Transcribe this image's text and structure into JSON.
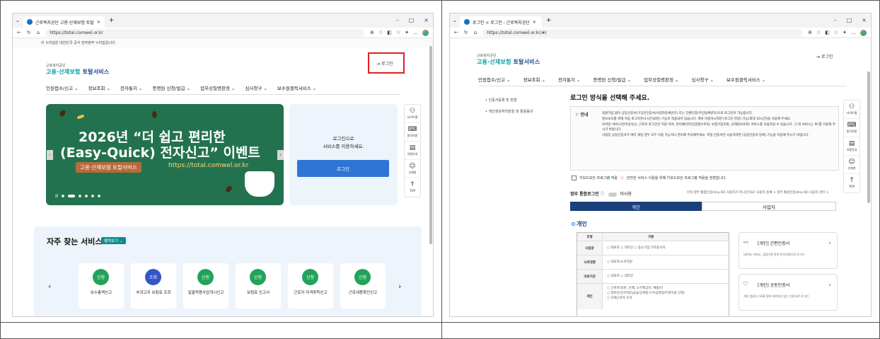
{
  "left": {
    "tab_title": "근로복지공단 고용·산재보험 토탈",
    "url": "https://total.comwel.or.kr",
    "gov_banner": "이 누리집은 대한민국 공식 전자정부 누리집입니다.",
    "brand_small": "근로복지공단",
    "brand_main_a": "고용·산재보험",
    "brand_main_b": " 토탈서비스",
    "login_link": "로그인",
    "nav": [
      "인원접수/신고 ⌄",
      "정보조회 ⌄",
      "전자통지 ⌄",
      "증명원 신청/발급 ⌄",
      "업무상질병판정 ⌄",
      "심사청구 ⌄",
      "보수원클릭서비스 ⌄"
    ],
    "hero": {
      "line1": "2026년 “더 쉽고 편리한",
      "line2": "(Easy-Quick) 전자신고” 이벤트",
      "pill": "고용·산재보험 토탈서비스",
      "url": "https://total.comwel.or.kr"
    },
    "login_box": {
      "line1": "로그인으로",
      "line2": "서비스를 이용하세요.",
      "button": "로그인"
    },
    "quick_nav": [
      "사이트맵",
      "원격지원",
      "이용안내",
      "산재봇",
      "TOP"
    ],
    "freq_title": "자주 찾는 서비스",
    "freq_more": "펼쳐보기 ⌄",
    "freq_cards": [
      {
        "badge": "신청",
        "label": "보수총액신고"
      },
      {
        "badge": "조회",
        "label": "부과고지 보험료 조회"
      },
      {
        "badge": "신청",
        "label": "일괄적용사업개시신고"
      },
      {
        "badge": "신청",
        "label": "보험료 신고서"
      },
      {
        "badge": "신청",
        "label": "근로자 자격취득신고"
      },
      {
        "badge": "신청",
        "label": "근로내용확인신고"
      }
    ]
  },
  "right": {
    "tab_title": "로그인 > 로그인 : 근로복지공단",
    "url": "https://total.comwel.or.kr/#/",
    "brand_small": "근로복지공단",
    "brand_main_a": "고용·산재보험",
    "brand_main_b": " 토탈서비스",
    "login_link": "로그인",
    "nav": [
      "민원접수/신고 ⌄",
      "정보조회 ⌄",
      "전자통지 ⌄",
      "증명원 신청/발급 ⌄",
      "업무상질병판정 ⌄",
      "심사청구 ⌄",
      "보수원클릭서비스 ⌄"
    ],
    "side": [
      "• 인증서등록 및 변경",
      "• 개인정보처리방침 및 활용동의"
    ],
    "heading": "로그인 방식을 선택해 주세요.",
    "notice_title": "안내",
    "notice": [
      "회원가입 없이 공동인증서(구공인인증서/사업자등록번호) 또는 간편인증(주민등록번호)으로 로그인이 가능합니다.",
      "정보보호를 위해 자동 로그아웃(1시간30분) 기능이 적용되어 있습니다. 계속 이용하시려면 [로그인 연장] 기능(최대 10시간)을 사용해 주세요.",
      "모바일 서비스(번호방식)는 근로자 로그인만 지원 하며, 마이페이지(민원접수조회, 보험가입조회, 산재정보조회) 서비스를 이용하실 수 있습니다. 그 외 서비스는 PC를 이용해 주시기 바랍니다.",
      "사업장 공동인증서가 여러 개일 경우 모두 이용 가능하니 관리에 주의해주세요. 특정 인증서만 사용하려면 [공동인증서 등록] 기능을 이용해 주시기 바랍니다."
    ],
    "kbd_label": "키보드보안 프로그램 적용",
    "kbd_note": "안전한 서비스 이용을 위해 키보드보안 프로그램 적용을 권장합니다.",
    "gov_login": "정부 통합로그인",
    "gov_toggle": "미사용",
    "gov_links": "아직 정부 통합인증(Any-ID) 사용자가 아니신가요?  사용자 등록 >   정부 통합인증(Any-ID) 사용자 관리 >",
    "tab_personal": "개인",
    "tab_business": "사업자",
    "section": "개인",
    "table_head": [
      "유형",
      "구분"
    ],
    "table_rows": [
      {
        "h": "사업장",
        "v": "○ 대표자  ○ 대리인  ○ 중소기업 가족종사자"
      },
      {
        "h": "사무대행",
        "v": "○ 대표자/소속직원"
      },
      {
        "h": "의료기관",
        "v": "○ 대표자  ○ 대리인"
      },
      {
        "h": "개인",
        "v": "○ 근로자(일반, 산재, 노무제공자, 예술인)\n○ 대리인(인어대리금급/상세청구/수급권방/트랜치클 신청)\n○ 산재근로자 유족"
      }
    ],
    "cards": [
      {
        "title": "[개인] 간편인증서",
        "desc": "네이버, 카카오, 금융기관 등의 전자서명으로 로그인"
      },
      {
        "title": "[개인] 공동인증서",
        "desc": "개인 컴퓨터, USB 등에 보관되어 있는 인증서로 로그인"
      }
    ],
    "quick_nav": [
      "사이트맵",
      "원격지원",
      "이용안내",
      "산재봇",
      "TOP"
    ]
  }
}
